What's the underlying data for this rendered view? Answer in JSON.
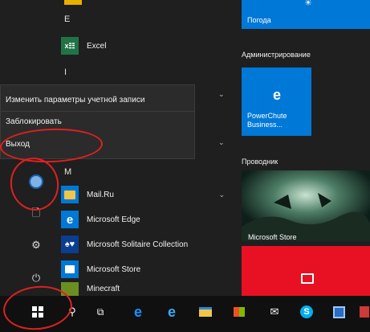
{
  "app_list": {
    "letter_e": "E",
    "letter_i": "I",
    "letter_m": "M",
    "excel": "Excel",
    "mailru": "Mail.Ru",
    "edge": "Microsoft Edge",
    "solitaire": "Microsoft Solitaire Collection",
    "store": "Microsoft Store",
    "minecraft": "Minecraft"
  },
  "account_menu": {
    "change_settings": "Изменить параметры учетной записи",
    "lock": "Заблокировать",
    "sign_out": "Выход"
  },
  "tiles": {
    "weather": "Погода",
    "admin_group": "Администрирование",
    "powerchute": "PowerChute Business...",
    "explorer_group": "Проводник",
    "store_tile": "Microsoft Store"
  },
  "colors": {
    "accent": "#0078d7",
    "red_tile": "#e81123",
    "annotation": "#e02020"
  }
}
